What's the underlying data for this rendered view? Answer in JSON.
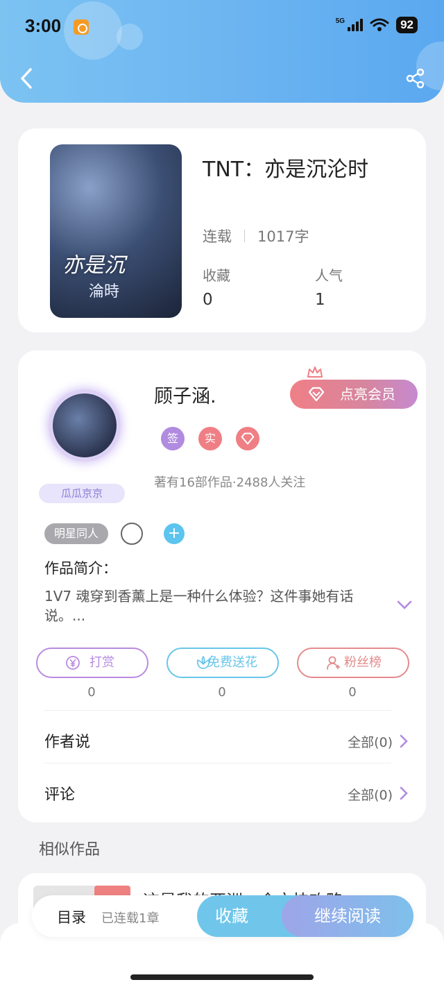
{
  "status_bar": {
    "time": "3:00",
    "network": "5G",
    "battery": "92"
  },
  "book": {
    "title": "TNT：亦是沉沦时",
    "status": "连载",
    "word_count": "1017字",
    "favorites_label": "收藏",
    "favorites_value": "0",
    "popularity_label": "人气",
    "popularity_value": "1",
    "cover_text_line1": "亦是沉",
    "cover_text_line2": "淪時"
  },
  "author": {
    "name": "顾子涵.",
    "avatar_badge": "瓜瓜京京",
    "vip_button": "点亮会员",
    "badges": [
      {
        "label": "签",
        "color": "#b18be0"
      },
      {
        "label": "实",
        "color": "#ef7f84"
      },
      {
        "label": "",
        "color": "#ef7f84"
      }
    ],
    "stats": "著有16部作品·2488人关注"
  },
  "tags": [
    "明星同人"
  ],
  "intro": {
    "label": "作品简介：",
    "text": "1V7 魂穿到香薰上是一种什么体验？这件事她有话说。..."
  },
  "actions": [
    {
      "label": "打赏",
      "count": "0",
      "color": "#b98be0",
      "icon": "yen-coin-icon"
    },
    {
      "label": "免费送花",
      "count": "0",
      "color": "#67c6ea",
      "icon": "flower-icon"
    },
    {
      "label": "粉丝榜",
      "count": "0",
      "color": "#e48a8c",
      "icon": "fan-list-icon"
    }
  ],
  "rows": [
    {
      "label": "作者说",
      "right": "全部(0)"
    },
    {
      "label": "评论",
      "right": "全部(0)"
    }
  ],
  "similar": {
    "title": "相似作品",
    "first_item_partial": "这是我的亚洲，全文快攻略"
  },
  "bottom": {
    "toc": "目录",
    "serial": "已连载1章",
    "favorite": "收藏",
    "continue": "继续阅读"
  },
  "colors": {
    "header": "#6bb4f1",
    "accent_purple": "#b18be0",
    "accent_pink": "#ef7f84",
    "accent_blue": "#67c6ea"
  }
}
